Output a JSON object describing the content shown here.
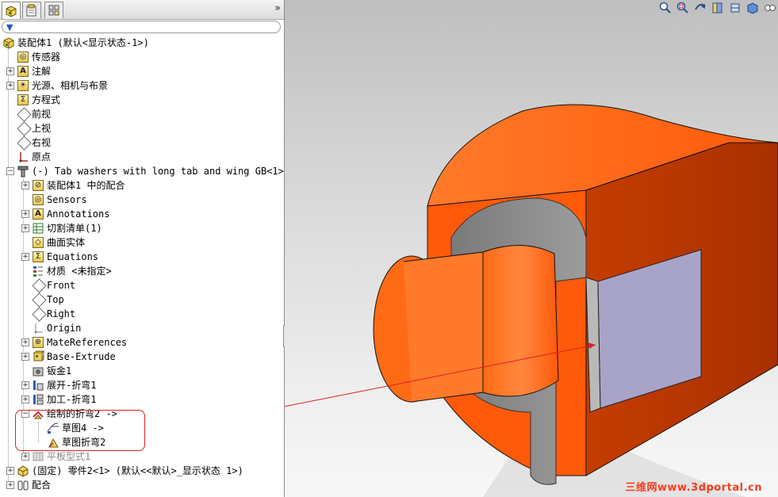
{
  "panel": {
    "tabs": [
      {
        "name": "feature-manager-tab",
        "icon": "feature-tree-icon"
      },
      {
        "name": "property-manager-tab",
        "icon": "property-icon"
      },
      {
        "name": "configuration-manager-tab",
        "icon": "configuration-icon"
      }
    ],
    "expand_label": "»"
  },
  "tree": {
    "root": "装配体1  (默认<显示状态-1>)",
    "sensors": "传感器",
    "annotations": "注解",
    "lights": "光源、相机与布景",
    "equations": "方程式",
    "front": "前视",
    "top": "上视",
    "right": "右视",
    "origin": "原点",
    "part1": "(-) Tab washers with long tab and wing GB<1>",
    "p_mates": "装配体1 中的配合",
    "p_sensors": "Sensors",
    "p_annotations": "Annotations",
    "p_cutlist": "切割清单(1)",
    "p_surface": "曲面实体",
    "p_equations": "Equations",
    "p_material": "材质 <未指定>",
    "p_front": "Front",
    "p_top": "Top",
    "p_right": "Right",
    "p_origin": "Origin",
    "p_materefs": "MateReferences",
    "p_baseextrude": "Base-Extrude",
    "p_sheetmetal": "钣金1",
    "p_unfold": "展开-折弯1",
    "p_process": "加工-折弯1",
    "p_sketchbend": "绘制的折弯2 ->",
    "p_sketch4": "草图4 ->",
    "p_sketchbend_sub": "草图折弯2",
    "p_flatpattern": "平板型式1",
    "part2": "(固定) 零件2<1> (默认<<默认>_显示状态 1>)",
    "mates": "配合"
  },
  "viewport": {
    "toolbar_icons": [
      "zoom-to-fit-icon",
      "zoom-area-icon",
      "previous-view-icon",
      "section-view-icon",
      "view-orientation-icon",
      "display-style-icon",
      "hide-show-icon"
    ],
    "watermark": "三维网www.3dportal.cn"
  },
  "colors": {
    "part_orange": "#ff5a0a",
    "part_shadow": "#b33300",
    "washer_gray": "#8e8e8e",
    "tab_face": "#a8a4c8",
    "callout_red": "#e02020"
  }
}
